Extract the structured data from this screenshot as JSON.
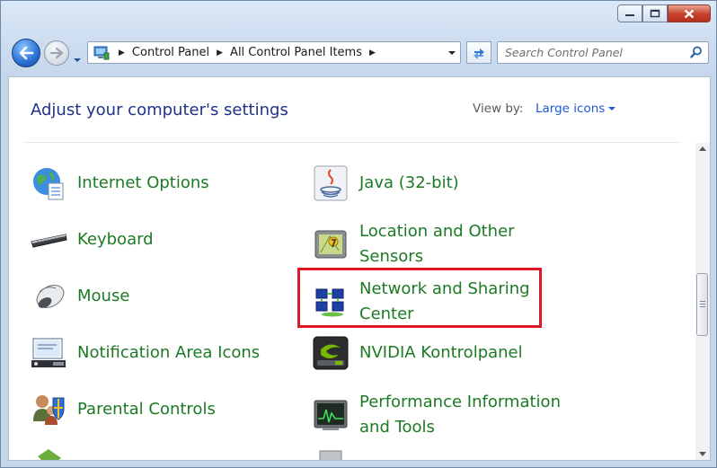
{
  "window": {
    "caption": {
      "minimize": "minimize",
      "maximize": "maximize",
      "close": "close"
    }
  },
  "address": {
    "crumbs": [
      "Control Panel",
      "All Control Panel Items"
    ]
  },
  "search": {
    "placeholder": "Search Control Panel"
  },
  "header": {
    "title": "Adjust your computer's settings",
    "view_by_label": "View by:",
    "view_by_value": "Large icons"
  },
  "items_left": [
    {
      "label": "Internet Options",
      "icon": "internet-options-icon"
    },
    {
      "label": "Keyboard",
      "icon": "keyboard-icon"
    },
    {
      "label": "Mouse",
      "icon": "mouse-icon"
    },
    {
      "label": "Notification Area Icons",
      "icon": "notification-area-icon"
    },
    {
      "label": "Parental Controls",
      "icon": "parental-controls-icon"
    }
  ],
  "items_right": [
    {
      "label": "Java (32-bit)",
      "icon": "java-icon"
    },
    {
      "label": "Location and Other Sensors",
      "icon": "location-sensors-icon"
    },
    {
      "label": "Network and Sharing Center",
      "icon": "network-sharing-icon"
    },
    {
      "label": "NVIDIA Kontrolpanel",
      "icon": "nvidia-icon"
    },
    {
      "label": "Performance Information and Tools",
      "icon": "performance-icon"
    }
  ],
  "colors": {
    "link_green": "#1c7a24",
    "title_blue": "#1e3287",
    "highlight_red": "#e0162b"
  }
}
